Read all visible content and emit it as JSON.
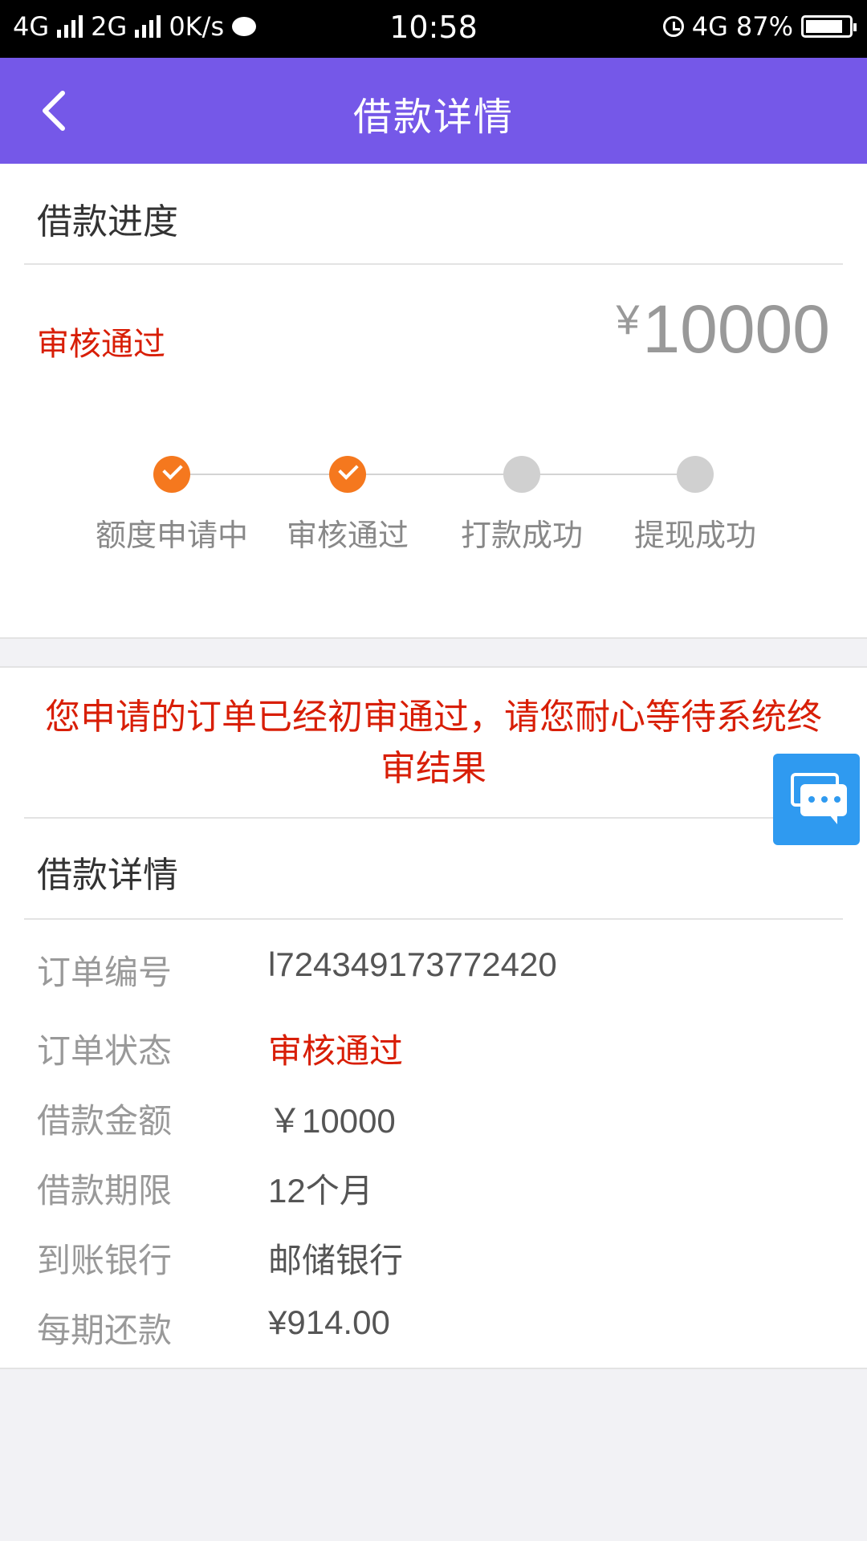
{
  "status_bar": {
    "net1": "4G",
    "net2": "2G",
    "speed": "0K/s",
    "time": "10:58",
    "net3": "4G",
    "battery": "87%",
    "battery_level": 0.87
  },
  "header": {
    "title": "借款详情"
  },
  "progress": {
    "section_title": "借款进度",
    "status": "审核通过",
    "amount": "10000",
    "currency": "¥",
    "steps": [
      {
        "label": "额度申请中",
        "done": true
      },
      {
        "label": "审核通过",
        "done": true
      },
      {
        "label": "打款成功",
        "done": false
      },
      {
        "label": "提现成功",
        "done": false
      }
    ]
  },
  "notice": "您申请的订单已经初审通过，请您耐心等待系统终审结果",
  "details": {
    "section_title": "借款详情",
    "rows": [
      {
        "label": "订单编号",
        "value": "l724349173772420"
      },
      {
        "label": "订单状态",
        "value": "审核通过"
      },
      {
        "label": "借款金额",
        "value": "￥10000"
      },
      {
        "label": "借款期限",
        "value": "12个月"
      },
      {
        "label": "到账银行",
        "value": "邮储银行"
      },
      {
        "label": "每期还款",
        "value": "¥914.00"
      }
    ]
  },
  "colors": {
    "header_bg": "#7558e8",
    "accent_red": "#d81e06",
    "step_done": "#f5781e",
    "chat_button": "#2f9af0"
  }
}
